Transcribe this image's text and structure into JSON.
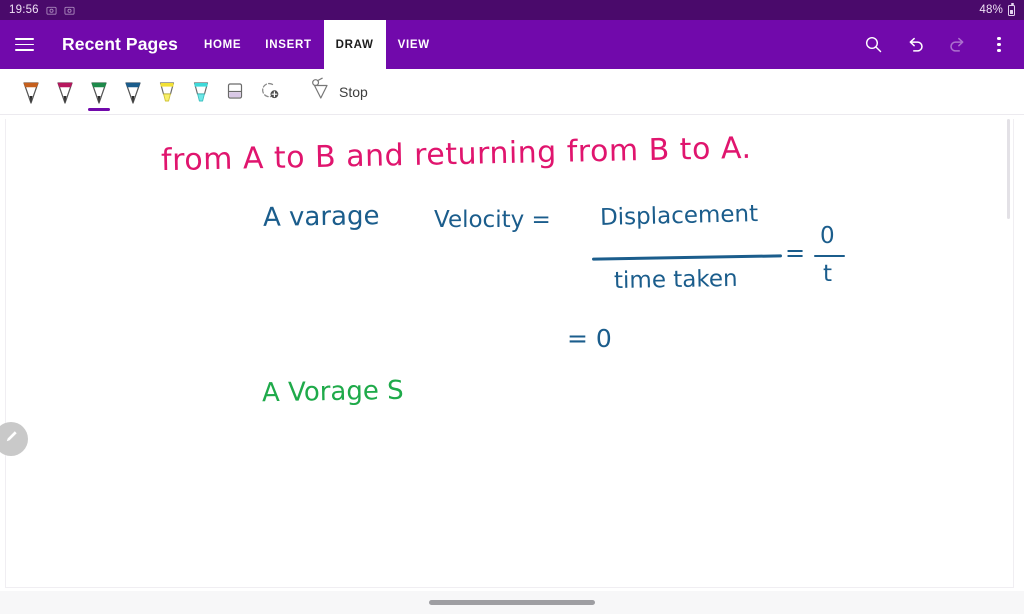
{
  "status_bar": {
    "clock": "19:56",
    "battery_percent": "48%",
    "left_icons": [
      "screenshot-indicator-icon",
      "screenshot-indicator-icon"
    ],
    "background_color": "#4a0a6b"
  },
  "app_bar": {
    "menu_icon": "hamburger-menu-icon",
    "title": "Recent Pages",
    "background_color": "#7109ab",
    "tabs": [
      {
        "label": "HOME",
        "active": false
      },
      {
        "label": "INSERT",
        "active": false
      },
      {
        "label": "DRAW",
        "active": true
      },
      {
        "label": "VIEW",
        "active": false
      }
    ],
    "actions": [
      {
        "name": "search-icon",
        "enabled": true
      },
      {
        "name": "undo-icon",
        "enabled": true
      },
      {
        "name": "redo-icon",
        "enabled": false
      },
      {
        "name": "overflow-menu-icon",
        "enabled": true
      }
    ]
  },
  "toolbar": {
    "tools": [
      {
        "name": "pen-orange",
        "type": "pen",
        "color": "#c6601e",
        "selected": false
      },
      {
        "name": "pen-magenta",
        "type": "pen",
        "color": "#b7175e",
        "selected": false
      },
      {
        "name": "pen-green",
        "type": "pen",
        "color": "#1d8a4a",
        "selected": true
      },
      {
        "name": "pen-blue",
        "type": "pen",
        "color": "#1b5d8c",
        "selected": false
      },
      {
        "name": "highlighter-yellow",
        "type": "highlighter",
        "color": "#f2e135",
        "selected": false
      },
      {
        "name": "highlighter-cyan",
        "type": "highlighter",
        "color": "#3ed9d9",
        "selected": false
      },
      {
        "name": "eraser",
        "type": "eraser",
        "color": "#d9c8e6",
        "selected": false
      },
      {
        "name": "add-pen",
        "type": "add",
        "color": "#8a8a8a",
        "selected": false
      }
    ],
    "stop": {
      "icon": "stop-ink-icon",
      "label": "Stop"
    },
    "selection_underline_color": "#7109ab"
  },
  "canvas": {
    "ink_colors": {
      "pink": "#e0156e",
      "blue": "#1b5d8c",
      "green": "#1faa4a"
    },
    "notes": [
      {
        "id": "line1",
        "text": "from  A  to  B   and  returning  from  B  to A.",
        "color": "pink"
      },
      {
        "id": "line2a",
        "text": "A varage",
        "color": "blue"
      },
      {
        "id": "line2b",
        "text": "Velocity  =",
        "color": "blue"
      },
      {
        "id": "frac-numerator",
        "text": "Displacement",
        "color": "blue"
      },
      {
        "id": "frac-denominator",
        "text": "time  taken",
        "color": "blue"
      },
      {
        "id": "equals2",
        "text": "=",
        "color": "blue"
      },
      {
        "id": "frac2-numerator",
        "text": "0",
        "color": "blue"
      },
      {
        "id": "frac2-denominator",
        "text": "t",
        "color": "blue"
      },
      {
        "id": "line3",
        "text": "=   0",
        "color": "blue"
      },
      {
        "id": "line4",
        "text": "A Vorage  S",
        "color": "green"
      }
    ],
    "fab_icon": "pencil-icon"
  },
  "bottom_nav": {
    "gesture_pill": "home-gesture-pill"
  }
}
